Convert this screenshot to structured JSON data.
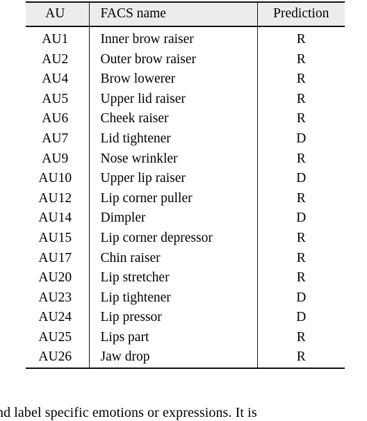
{
  "document": {
    "type": "academic-paper-table",
    "table": {
      "name": "facs-action-units-prediction-table",
      "columns": [
        {
          "key": "au",
          "header": "AU",
          "align": "center"
        },
        {
          "key": "facs_name",
          "header": "FACS name",
          "align": "left"
        },
        {
          "key": "prediction",
          "header": "Prediction",
          "align": "center"
        }
      ],
      "rows": [
        {
          "au": "AU1",
          "facs_name": "Inner brow raiser",
          "prediction": "R"
        },
        {
          "au": "AU2",
          "facs_name": "Outer brow raiser",
          "prediction": "R"
        },
        {
          "au": "AU4",
          "facs_name": "Brow lowerer",
          "prediction": "R"
        },
        {
          "au": "AU5",
          "facs_name": "Upper lid raiser",
          "prediction": "R"
        },
        {
          "au": "AU6",
          "facs_name": "Cheek raiser",
          "prediction": "R"
        },
        {
          "au": "AU7",
          "facs_name": "Lid tightener",
          "prediction": "D"
        },
        {
          "au": "AU9",
          "facs_name": "Nose wrinkler",
          "prediction": "R"
        },
        {
          "au": "AU10",
          "facs_name": "Upper lip raiser",
          "prediction": "D"
        },
        {
          "au": "AU12",
          "facs_name": "Lip corner puller",
          "prediction": "R"
        },
        {
          "au": "AU14",
          "facs_name": "Dimpler",
          "prediction": "D"
        },
        {
          "au": "AU15",
          "facs_name": "Lip corner depressor",
          "prediction": "R"
        },
        {
          "au": "AU17",
          "facs_name": "Chin raiser",
          "prediction": "R"
        },
        {
          "au": "AU20",
          "facs_name": "Lip stretcher",
          "prediction": "R"
        },
        {
          "au": "AU23",
          "facs_name": "Lip tightener",
          "prediction": "D"
        },
        {
          "au": "AU24",
          "facs_name": "Lip pressor",
          "prediction": "D"
        },
        {
          "au": "AU25",
          "facs_name": "Lips part",
          "prediction": "R"
        },
        {
          "au": "AU26",
          "facs_name": "Jaw drop",
          "prediction": "R"
        }
      ]
    },
    "body_text_fragment": "and label specific emotions or expressions.  It is"
  },
  "style": {
    "header_background": "#ececec",
    "rule_color": "#111111",
    "text_color": "#000000",
    "page_background": "#ffffff"
  }
}
